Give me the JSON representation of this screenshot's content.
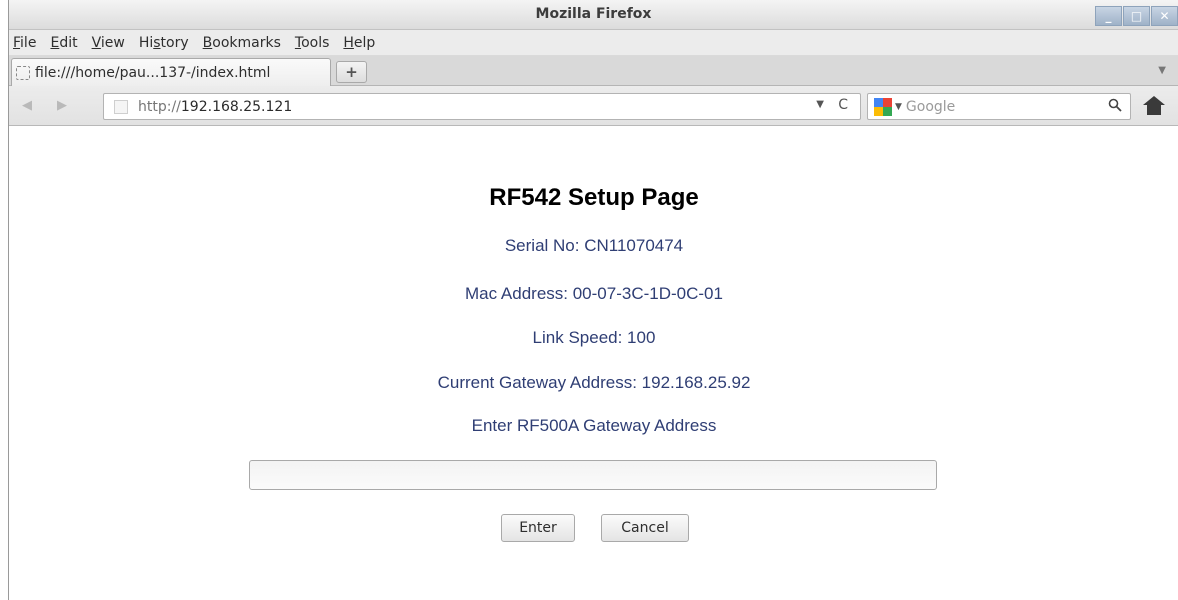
{
  "window": {
    "title": "Mozilla Firefox",
    "controls": {
      "minimize": "_",
      "maximize": "□",
      "close": "✕"
    }
  },
  "menubar": {
    "items": [
      {
        "acc": "F",
        "rest": "ile"
      },
      {
        "acc": "E",
        "rest": "dit"
      },
      {
        "acc": "V",
        "rest": "iew"
      },
      {
        "pre": "Hi",
        "acc": "s",
        "rest": "tory"
      },
      {
        "acc": "B",
        "rest": "ookmarks"
      },
      {
        "acc": "T",
        "rest": "ools"
      },
      {
        "acc": "H",
        "rest": "elp"
      }
    ]
  },
  "tabs": {
    "active_label": "file:///home/pau...137-/index.html",
    "new_tab_symbol": "+",
    "list_symbol": "▼"
  },
  "navbar": {
    "back_symbol": "◀",
    "forward_symbol": "▶",
    "url_scheme": "http://",
    "url_host": "192.168.25.121",
    "url_dropdown": "▼",
    "reload_symbol": "C",
    "search_dropdown": "▼",
    "search_placeholder": "Google",
    "search_icon": "search-icon",
    "engine_colors": [
      "#4285f4",
      "#ea4335",
      "#fbbc05",
      "#34a853"
    ]
  },
  "page": {
    "title": "RF542 Setup Page",
    "serial": "Serial No: CN11070474",
    "mac": "Mac Address: 00-07-3C-1D-0C-01",
    "link_speed": "Link Speed: 100",
    "current_gateway": "Current Gateway Address: 192.168.25.92",
    "prompt": "Enter RF500A Gateway Address",
    "gateway_input_value": "",
    "enter_label": "Enter",
    "cancel_label": "Cancel",
    "text_color": "#2f3e74"
  }
}
